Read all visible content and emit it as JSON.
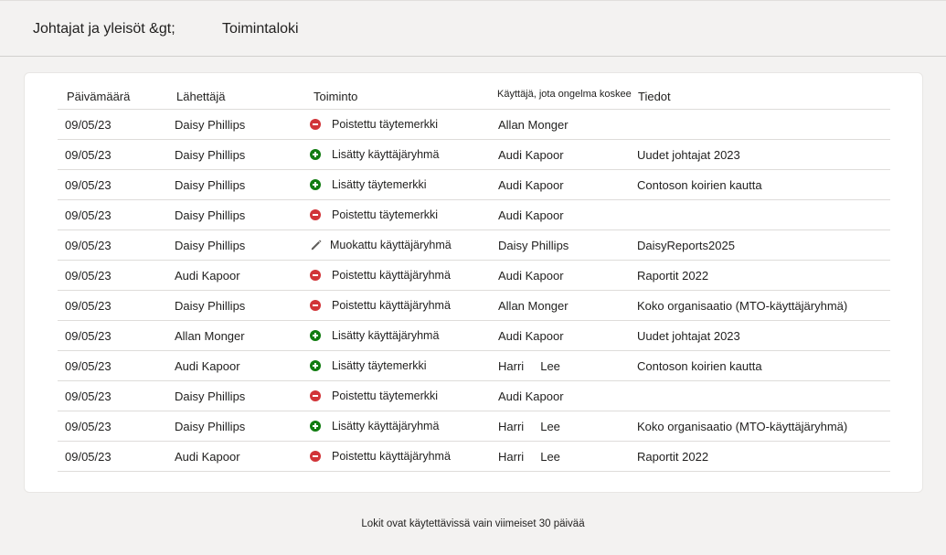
{
  "breadcrumb": {
    "parent": "Johtajat ja yleisöt &gt;",
    "current": "Toimintaloki"
  },
  "table": {
    "headers": {
      "date": "Päivämäärä",
      "sender": "Lähettäjä",
      "action": "Toiminto",
      "user": "Käyttäjä, jota ongelma koskee",
      "details": "Tiedot"
    },
    "rows": [
      {
        "date": "09/05/23",
        "sender": "Daisy Phillips",
        "icon": "remove-icon",
        "action": "Poistettu täytemerkki",
        "user": "Allan Monger",
        "details": ""
      },
      {
        "date": "09/05/23",
        "sender": "Daisy Phillips",
        "icon": "add-icon",
        "action": "Lisätty käyttäjäryhmä",
        "user": "Audi Kapoor",
        "details": "Uudet johtajat 2023"
      },
      {
        "date": "09/05/23",
        "sender": "Daisy Phillips",
        "icon": "add-icon",
        "action": "Lisätty täytemerkki",
        "user": "Audi Kapoor",
        "details": "Contoson koirien kautta"
      },
      {
        "date": "09/05/23",
        "sender": "Daisy Phillips",
        "icon": "remove-icon",
        "action": "Poistettu täytemerkki",
        "user": "Audi Kapoor",
        "details": ""
      },
      {
        "date": "09/05/23",
        "sender": "Daisy Phillips",
        "icon": "edit-icon",
        "action": "Muokattu käyttäjäryhmä",
        "user": "Daisy Phillips",
        "details": "DaisyReports2025"
      },
      {
        "date": "09/05/23",
        "sender": "Audi Kapoor",
        "icon": "remove-icon",
        "action": "Poistettu käyttäjäryhmä",
        "user": "Audi Kapoor",
        "details": "Raportit 2022"
      },
      {
        "date": "09/05/23",
        "sender": "Daisy Phillips",
        "icon": "remove-icon",
        "action": "Poistettu käyttäjäryhmä",
        "user": "Allan Monger",
        "details": "Koko organisaatio (MTO-käyttäjäryhmä)"
      },
      {
        "date": "09/05/23",
        "sender": "Allan Monger",
        "icon": "add-icon",
        "action": "Lisätty käyttäjäryhmä",
        "user": "Audi Kapoor",
        "details": "Uudet johtajat 2023"
      },
      {
        "date": "09/05/23",
        "sender": "Audi Kapoor",
        "icon": "add-icon",
        "action": "Lisätty täytemerkki",
        "user": "Harri     Lee",
        "details": "Contoson koirien kautta"
      },
      {
        "date": "09/05/23",
        "sender": "Daisy Phillips",
        "icon": "remove-icon",
        "action": "Poistettu täytemerkki",
        "user": "Audi Kapoor",
        "details": ""
      },
      {
        "date": "09/05/23",
        "sender": "Daisy Phillips",
        "icon": "add-icon",
        "action": "Lisätty käyttäjäryhmä",
        "user": "Harri     Lee",
        "details": "Koko organisaatio (MTO-käyttäjäryhmä)"
      },
      {
        "date": "09/05/23",
        "sender": "Audi Kapoor",
        "icon": "remove-icon",
        "action": "Poistettu käyttäjäryhmä",
        "user": "Harri     Lee",
        "details": "Raportit 2022"
      }
    ]
  },
  "footer": {
    "note": "Lokit ovat käytettävissä vain viimeiset 30 päivää"
  },
  "colors": {
    "remove": "#d13438",
    "add": "#107c10",
    "edit": "#605e5c"
  }
}
